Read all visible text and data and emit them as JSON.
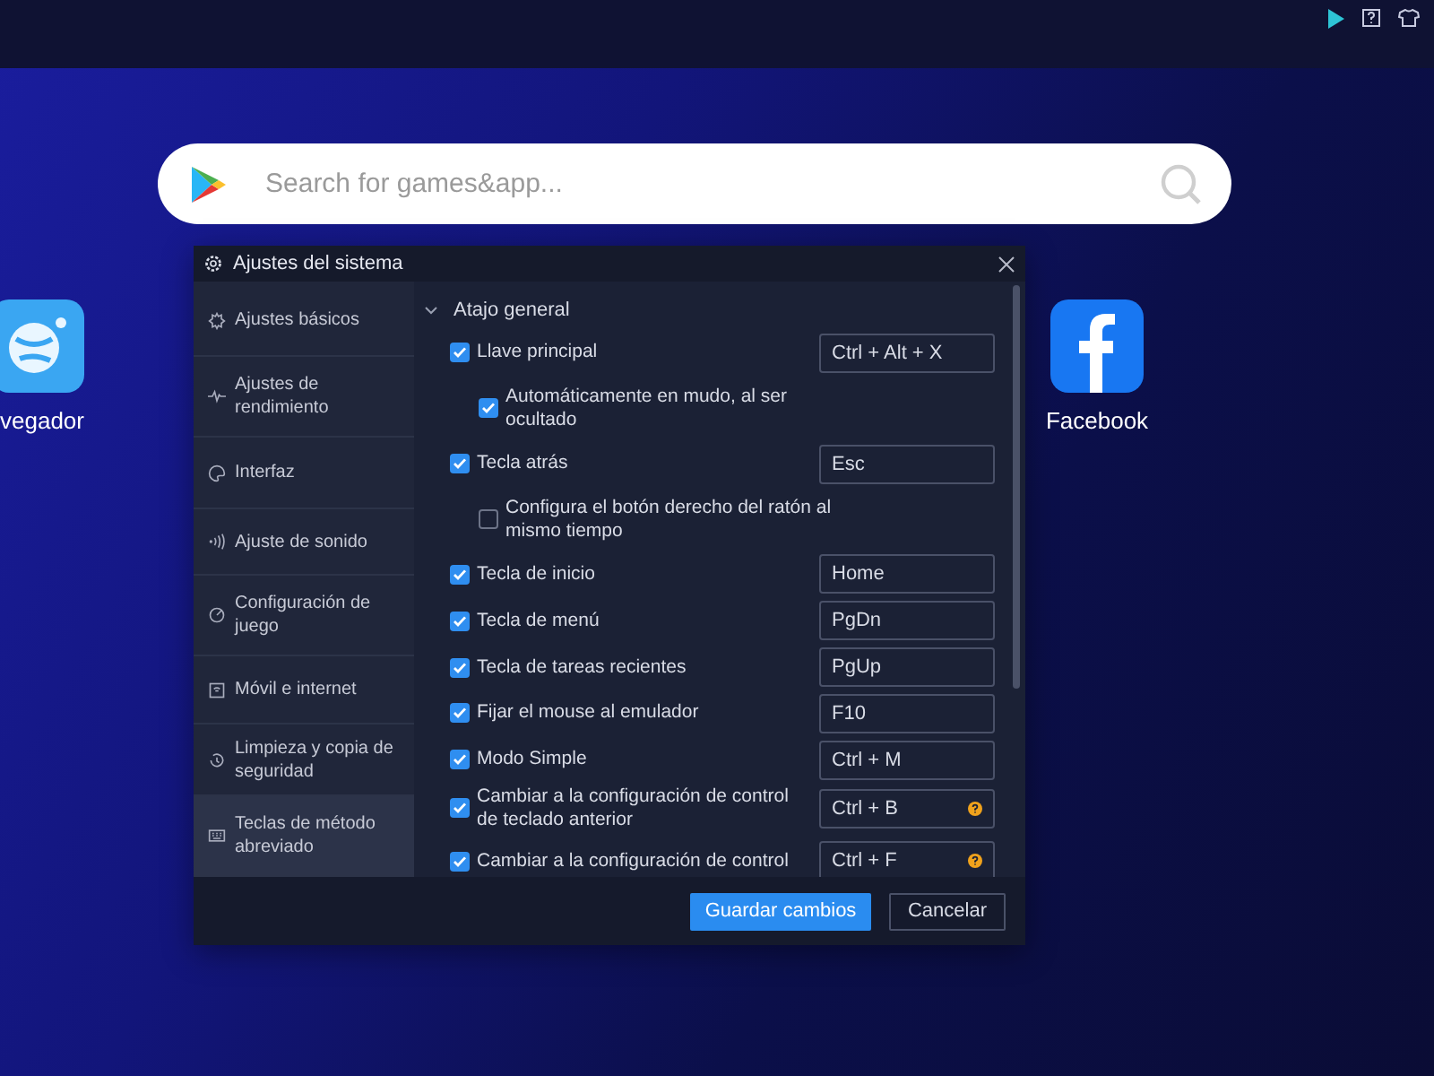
{
  "search": {
    "placeholder": "Search for games&app..."
  },
  "desktop_apps": [
    {
      "kind": "browser",
      "label": "vegador"
    },
    {
      "kind": "facebook",
      "label": "Facebook"
    }
  ],
  "dialog": {
    "title": "Ajustes del sistema",
    "sidebar": {
      "items": [
        {
          "label": "Ajustes básicos",
          "selected": false
        },
        {
          "label": "Ajustes de rendimiento",
          "selected": false
        },
        {
          "label": "Interfaz",
          "selected": false
        },
        {
          "label": "Ajuste de sonido",
          "selected": false
        },
        {
          "label": "Configuración de juego",
          "selected": false
        },
        {
          "label": "Móvil e internet",
          "selected": false
        },
        {
          "label": "Limpieza y copia de seguridad",
          "selected": false
        },
        {
          "label": "Teclas de método abreviado",
          "selected": true
        }
      ]
    },
    "section": {
      "title": "Atajo general",
      "expanded": true
    },
    "shortcuts": [
      {
        "label": "Llave principal",
        "checked": true,
        "value": "Ctrl + Alt + X",
        "help": false,
        "children": [
          {
            "label": "Automáticamente en mudo, al ser ocultado",
            "checked": true
          }
        ]
      },
      {
        "label": "Tecla atrás",
        "checked": true,
        "value": "Esc",
        "help": false,
        "children": [
          {
            "label": "Configura el botón derecho del ratón al mismo tiempo",
            "checked": false
          }
        ]
      },
      {
        "label": "Tecla de inicio",
        "checked": true,
        "value": "Home",
        "help": false
      },
      {
        "label": "Tecla de menú",
        "checked": true,
        "value": "PgDn",
        "help": false
      },
      {
        "label": "Tecla de tareas recientes",
        "checked": true,
        "value": "PgUp",
        "help": false
      },
      {
        "label": "Fijar el mouse al emulador",
        "checked": true,
        "value": "F10",
        "help": false
      },
      {
        "label": "Modo Simple",
        "checked": true,
        "value": "Ctrl + M",
        "help": false
      },
      {
        "label": "Cambiar a la configuración de control de teclado anterior",
        "checked": true,
        "value": "Ctrl + B",
        "help": true
      },
      {
        "label": "Cambiar a la configuración de control",
        "checked": true,
        "value": "Ctrl + F",
        "help": true
      }
    ],
    "buttons": [
      {
        "kind": "primary",
        "label": "Guardar cambios"
      },
      {
        "kind": "secondary",
        "label": "Cancelar"
      }
    ]
  }
}
